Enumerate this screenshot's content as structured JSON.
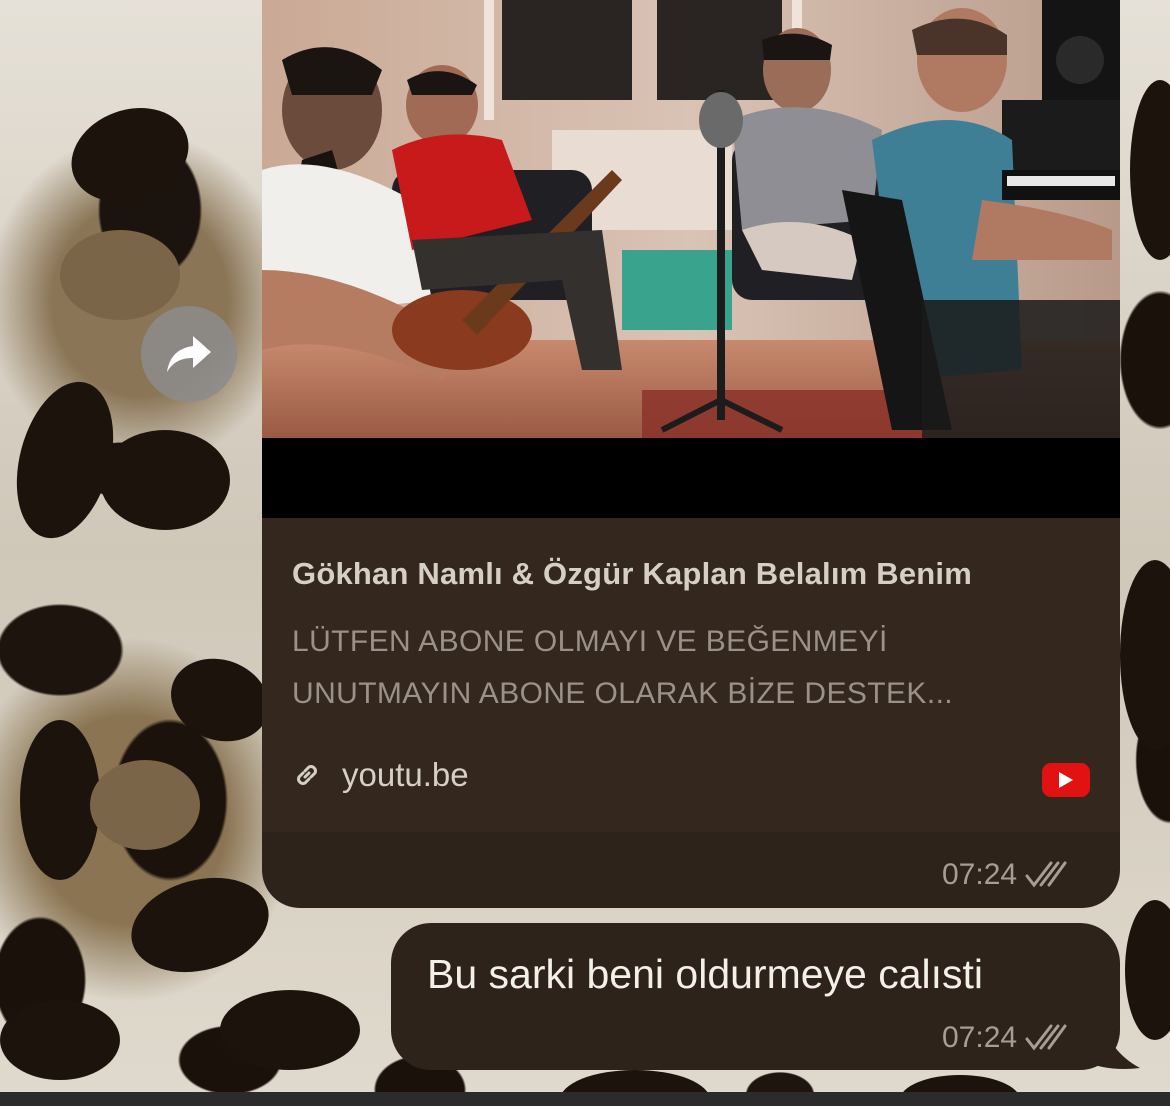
{
  "colors": {
    "bubble_bg": "#2e231b",
    "link_card_bg": "#33271e",
    "youtube_red": "#e21212",
    "forward_button_bg": "#8c8c8c"
  },
  "icons": {
    "forward": "forward-arrow-icon",
    "link": "link-icon",
    "youtube": "youtube-icon",
    "read_receipt": "double-check-icon"
  },
  "link_preview": {
    "title": "Gökhan Namlı & Özgür Kaplan Belalım Benim",
    "description_lines": [
      "LÜTFEN ABONE OLMAYI VE BEĞENMEYİ",
      "UNUTMAYIN ABONE OLARAK BİZE DESTEK..."
    ],
    "domain": "youtu.be",
    "time": "07:24"
  },
  "text_message": {
    "text": "Bu sarki beni oldurmeye calısti",
    "time": "07:24"
  }
}
